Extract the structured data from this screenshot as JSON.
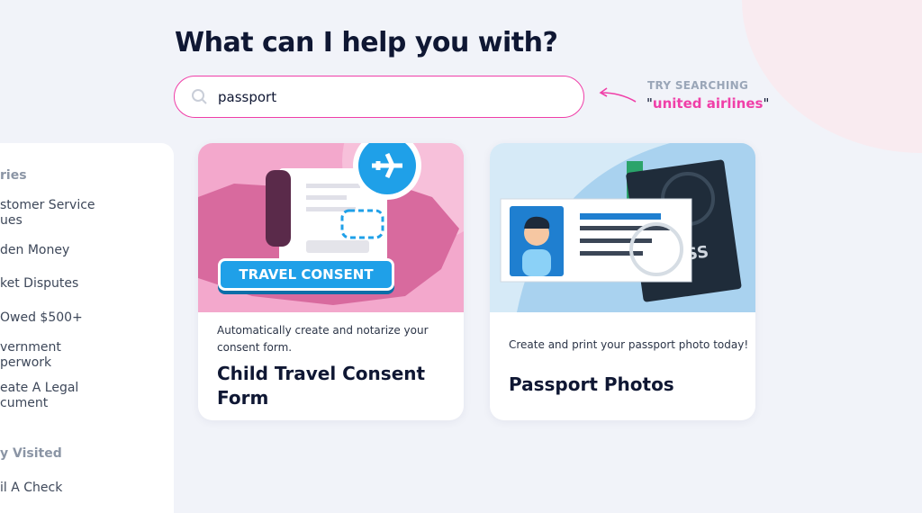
{
  "heading": "What can I help you with?",
  "search": {
    "value": "passport",
    "icon": "search-icon"
  },
  "suggestion": {
    "label": "TRY SEARCHING",
    "query": "united airlines",
    "open_quote": "\"",
    "close_quote": "\""
  },
  "sidebar": {
    "section1": "ries",
    "items": [
      "stomer Service",
      "ues",
      "den Money",
      "ket Disputes",
      "Owed $500+",
      "vernment",
      "perwork",
      "eate A Legal",
      "cument"
    ],
    "section2": "y Visited",
    "recent": [
      "il A Check"
    ]
  },
  "cards": [
    {
      "badge": "TRAVEL CONSENT",
      "description_lines": [
        "Automatically create and notarize your",
        "consent form."
      ],
      "title_lines": [
        "Child Travel Consent",
        "Form"
      ]
    },
    {
      "badge": "ASS",
      "description_lines": [
        "Create and print your passport photo today!"
      ],
      "title_lines": [
        "Passport Photos"
      ]
    }
  ],
  "colors": {
    "accent": "#f03fa8",
    "consent_bg": "#f3a8cc",
    "passport_bg": "#d6eaf7",
    "button_blue": "#1fa0e8"
  }
}
